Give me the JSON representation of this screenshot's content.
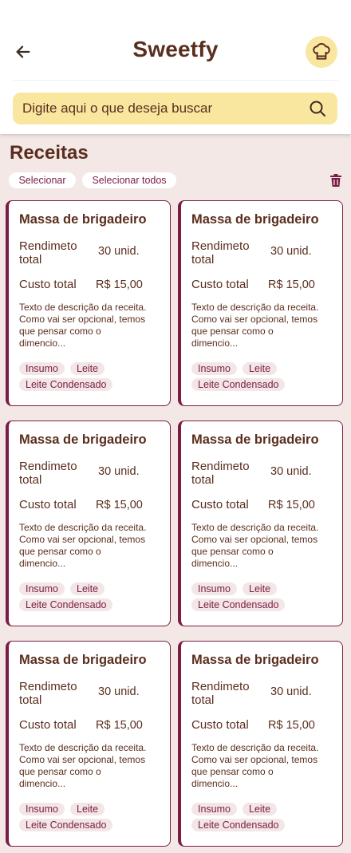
{
  "header": {
    "title": "Sweetfy",
    "back_icon": "arrow-left-icon",
    "avatar_icon": "chef-hat-icon",
    "avatar_bg": "#f9e79f"
  },
  "search": {
    "placeholder": "Digite aqui o que deseja buscar",
    "value": "",
    "icon": "search-icon"
  },
  "section": {
    "title": "Receitas",
    "select_label": "Selecionar",
    "select_all_label": "Selecionar todos",
    "delete_icon": "trash-icon"
  },
  "colors": {
    "accent": "#7a1c43",
    "text": "#5a2e1e",
    "background": "#f3e8e6",
    "yellow": "#f9e79f"
  },
  "recipes": [
    {
      "title": "Massa de brigadeiro",
      "yield_label": "Rendimeto total",
      "yield_value": "30 unid.",
      "cost_label": "Custo total",
      "cost_value": "R$ 15,00",
      "description": "Texto de descrição da receita. Como vai ser opcional, temos que pensar como o dimencio...",
      "tags": [
        "Insumo",
        "Leite",
        "Leite Condensado"
      ]
    },
    {
      "title": "Massa de brigadeiro",
      "yield_label": "Rendimeto total",
      "yield_value": "30 unid.",
      "cost_label": "Custo total",
      "cost_value": "R$ 15,00",
      "description": "Texto de descrição da receita. Como vai ser opcional, temos que pensar como o dimencio...",
      "tags": [
        "Insumo",
        "Leite",
        "Leite Condensado"
      ]
    },
    {
      "title": "Massa de brigadeiro",
      "yield_label": "Rendimeto total",
      "yield_value": "30 unid.",
      "cost_label": "Custo total",
      "cost_value": "R$ 15,00",
      "description": "Texto de descrição da receita. Como vai ser opcional, temos que pensar como o dimencio...",
      "tags": [
        "Insumo",
        "Leite",
        "Leite Condensado"
      ]
    },
    {
      "title": "Massa de brigadeiro",
      "yield_label": "Rendimeto total",
      "yield_value": "30 unid.",
      "cost_label": "Custo total",
      "cost_value": "R$ 15,00",
      "description": "Texto de descrição da receita. Como vai ser opcional, temos que pensar como o dimencio...",
      "tags": [
        "Insumo",
        "Leite",
        "Leite Condensado"
      ]
    },
    {
      "title": "Massa de brigadeiro",
      "yield_label": "Rendimeto total",
      "yield_value": "30 unid.",
      "cost_label": "Custo total",
      "cost_value": "R$ 15,00",
      "description": "Texto de descrição da receita. Como vai ser opcional, temos que pensar como o dimencio...",
      "tags": [
        "Insumo",
        "Leite",
        "Leite Condensado"
      ]
    },
    {
      "title": "Massa de brigadeiro",
      "yield_label": "Rendimeto total",
      "yield_value": "30 unid.",
      "cost_label": "Custo total",
      "cost_value": "R$ 15,00",
      "description": "Texto de descrição da receita. Como vai ser opcional, temos que pensar como o dimencio...",
      "tags": [
        "Insumo",
        "Leite",
        "Leite Condensado"
      ]
    }
  ]
}
